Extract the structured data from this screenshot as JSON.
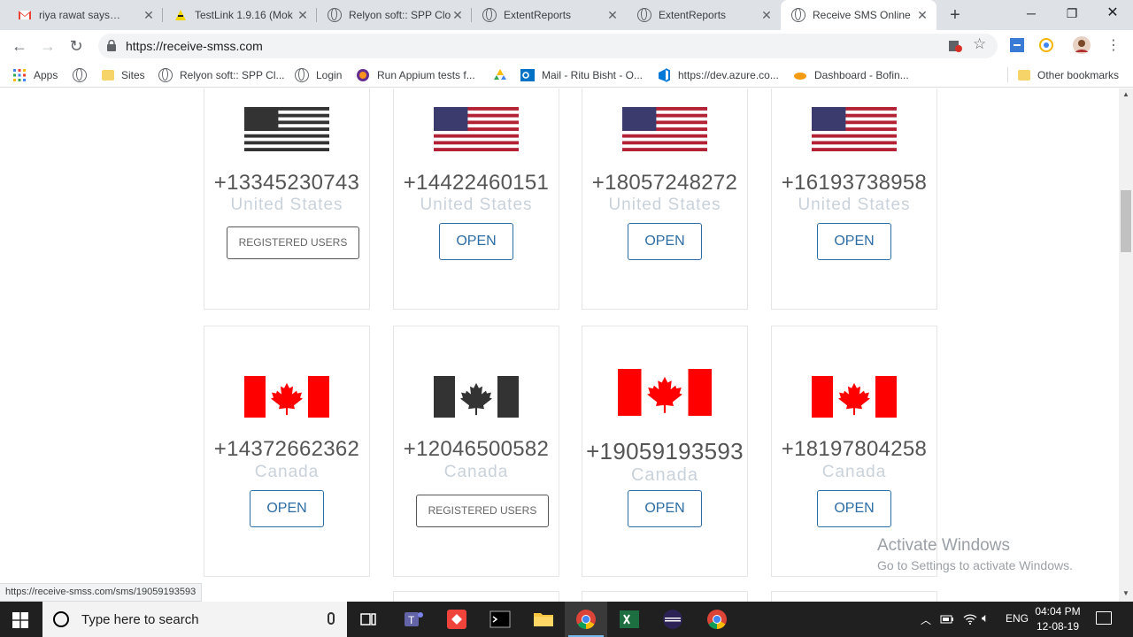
{
  "tabs": [
    {
      "title": "riya rawat says…",
      "icon": "gmail-icon"
    },
    {
      "title": "TestLink 1.9.16 (Mok",
      "icon": "testlink-icon"
    },
    {
      "title": "Relyon soft:: SPP Clo",
      "icon": "globe-icon"
    },
    {
      "title": "ExtentReports",
      "icon": "globe-icon"
    },
    {
      "title": "ExtentReports",
      "icon": "globe-icon"
    },
    {
      "title": "Receive SMS Online",
      "icon": "globe-icon",
      "active": true
    }
  ],
  "url": "https://receive-smss.com",
  "bookmarks": [
    {
      "label": "Apps"
    },
    {
      "label": ""
    },
    {
      "label": "Sites"
    },
    {
      "label": "Relyon soft:: SPP Cl..."
    },
    {
      "label": "Login"
    },
    {
      "label": "Run Appium tests f..."
    },
    {
      "label": ""
    },
    {
      "label": "Mail - Ritu Bisht - O..."
    },
    {
      "label": "https://dev.azure.co..."
    },
    {
      "label": "Dashboard - Bofin..."
    },
    {
      "label": "Other bookmarks"
    }
  ],
  "cards": [
    {
      "number": "+13345230743",
      "country": "United States",
      "button": "REGISTERED USERS",
      "flag": "us-gray"
    },
    {
      "number": "+14422460151",
      "country": "United States",
      "button": "OPEN",
      "flag": "us"
    },
    {
      "number": "+18057248272",
      "country": "United States",
      "button": "OPEN",
      "flag": "us"
    },
    {
      "number": "+16193738958",
      "country": "United States",
      "button": "OPEN",
      "flag": "us"
    },
    {
      "number": "+14372662362",
      "country": "Canada",
      "button": "OPEN",
      "flag": "ca"
    },
    {
      "number": "+12046500582",
      "country": "Canada",
      "button": "REGISTERED USERS",
      "flag": "ca-gray"
    },
    {
      "number": "+19059193593",
      "country": "Canada",
      "button": "OPEN",
      "flag": "ca"
    },
    {
      "number": "+18197804258",
      "country": "Canada",
      "button": "OPEN",
      "flag": "ca"
    }
  ],
  "status_url": "https://receive-smss.com/sms/19059193593",
  "watermark": {
    "title": "Activate Windows",
    "subtitle": "Go to Settings to activate Windows."
  },
  "taskbar": {
    "search_placeholder": "Type here to search",
    "lang": "ENG",
    "time": "04:04 PM",
    "date": "12-08-19"
  },
  "colors": {
    "flag_red": "#ff0000",
    "us_red": "#b22234",
    "us_blue": "#3c3b6e",
    "button_blue": "#2e6da4"
  }
}
